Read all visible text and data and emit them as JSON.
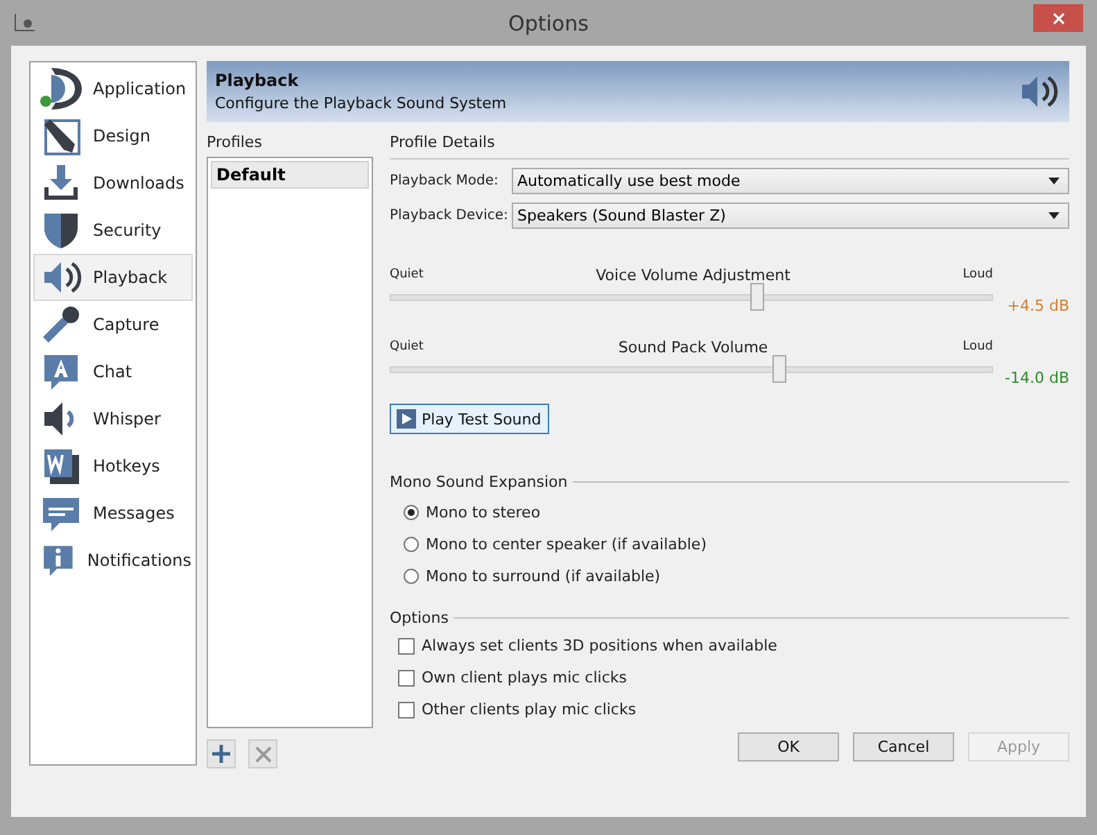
{
  "window": {
    "title": "Options"
  },
  "sidebar": {
    "items": [
      {
        "label": "Application",
        "selected": false
      },
      {
        "label": "Design",
        "selected": false
      },
      {
        "label": "Downloads",
        "selected": false
      },
      {
        "label": "Security",
        "selected": false
      },
      {
        "label": "Playback",
        "selected": true
      },
      {
        "label": "Capture",
        "selected": false
      },
      {
        "label": "Chat",
        "selected": false
      },
      {
        "label": "Whisper",
        "selected": false
      },
      {
        "label": "Hotkeys",
        "selected": false
      },
      {
        "label": "Messages",
        "selected": false
      },
      {
        "label": "Notifications",
        "selected": false
      }
    ]
  },
  "header": {
    "title": "Playback",
    "subtitle": "Configure the Playback Sound System"
  },
  "profiles": {
    "label": "Profiles",
    "items": [
      {
        "label": "Default",
        "selected": true
      }
    ]
  },
  "details": {
    "label": "Profile Details",
    "fields": [
      {
        "label": "Playback Mode:",
        "value": "Automatically use best mode"
      },
      {
        "label": "Playback Device:",
        "value": "Speakers (Sound Blaster Z)"
      }
    ],
    "sliders": [
      {
        "title": "Voice Volume Adjustment",
        "min_label": "Quiet",
        "max_label": "Loud",
        "level": 0.61,
        "reading": "+4.5 dB",
        "color": "#d0802f"
      },
      {
        "title": "Sound Pack Volume",
        "min_label": "Quiet",
        "max_label": "Loud",
        "level": 0.646,
        "reading": "-14.0 dB",
        "color": "#2e8b2e"
      }
    ],
    "test_button": "Play Test Sound"
  },
  "mono": {
    "title": "Mono Sound Expansion",
    "options": [
      {
        "label": "Mono to stereo",
        "selected": true
      },
      {
        "label": "Mono to center speaker (if available)",
        "selected": false
      },
      {
        "label": "Mono to surround (if available)",
        "selected": false
      }
    ]
  },
  "options": {
    "title": "Options",
    "items": [
      {
        "label": "Always set clients 3D positions when available",
        "checked": false
      },
      {
        "label": "Own client plays mic clicks",
        "checked": false
      },
      {
        "label": "Other clients play mic clicks",
        "checked": false
      }
    ]
  },
  "buttons": [
    {
      "label": "OK",
      "disabled": false
    },
    {
      "label": "Cancel",
      "disabled": false
    },
    {
      "label": "Apply",
      "disabled": true
    }
  ]
}
